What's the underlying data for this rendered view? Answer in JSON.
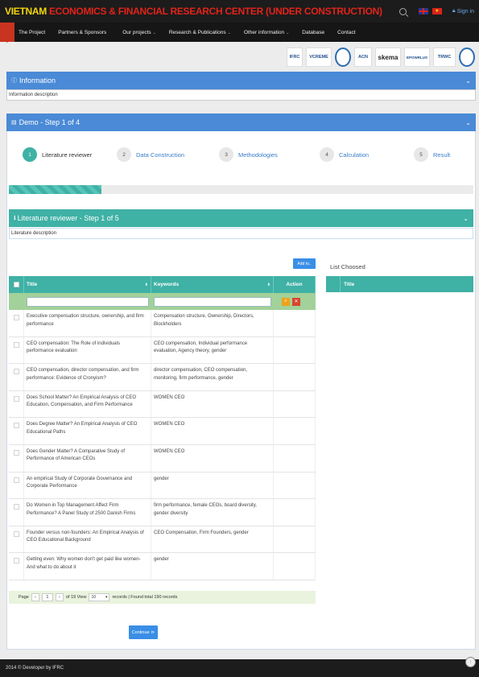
{
  "header": {
    "brand_a": "VIETNAM",
    "brand_b": "ECONOMICS & FINANCIAL RESEARCH CENTER (UNDER CONSTRUCTION)",
    "flag_vn_star": "★",
    "signin": "Sign in"
  },
  "nav": {
    "items": [
      "The Project",
      "Partners & Sponsors",
      "Our projects",
      "Research & Publications",
      "Other information",
      "Database",
      "Contact"
    ],
    "caret": "⌄"
  },
  "partners": [
    "IFRC",
    "VCREME",
    "",
    "ACN",
    "skema",
    "EPOWRLUS",
    "TRWC",
    ""
  ],
  "info": {
    "title": "Information",
    "description": "Information description"
  },
  "demo": {
    "title": "Demo - Step 1 of 4",
    "steps": [
      {
        "num": "1",
        "label": "Literature reviewer"
      },
      {
        "num": "2",
        "label": "Data Construction"
      },
      {
        "num": "3",
        "label": "Methodologies"
      },
      {
        "num": "4",
        "label": "Calculation"
      },
      {
        "num": "5",
        "label": "Result"
      }
    ],
    "progress": 0.2
  },
  "literature": {
    "title": "Literature reviewer - Step 1 of 5",
    "description": "Literature description",
    "add_to": "Add to..",
    "list_choosed": "List Choosed",
    "columns": {
      "title": "Title",
      "keywords": "Keywords",
      "action": "Action"
    },
    "rows": [
      {
        "title": "Executive compensation structure, ownership, and firm performance",
        "keywords": "Compensation structure, Ownership, Directors, Blockholders"
      },
      {
        "title": "CEO compensation: The Role of individuals performance evaluation",
        "keywords": "CEO compensation, Individual performance evaluation, Agency theory, gender"
      },
      {
        "title": "CEO compensation, director compensation, and firm performance: Evidence of Cronyism?",
        "keywords": "director compensation, CEO compensation, monitoring, firm performance, gender"
      },
      {
        "title": "Does School Matter? An Empirical Analysis of CEO Education, Compensation, and Firm Performance",
        "keywords": "WOMEN CEO"
      },
      {
        "title": "Does Degree Matter? An Empirical Analysis of CEO Educational Paths",
        "keywords": "WOMEN CEO"
      },
      {
        "title": "Does Gender Matter? A Comparative Study of Performance of American CEOs",
        "keywords": "WOMEN CEO"
      },
      {
        "title": "An empirical Study of Corporate Governance and Corporate Performance",
        "keywords": "gender"
      },
      {
        "title": "Do Women in Top Management Affect Firm Performance? A Panel Study of 2500 Danish Firms",
        "keywords": "firm performance, female CEOs, board diversity, gender diversity"
      },
      {
        "title": "Founder versus non-founders: An Empirical Analysis of CEO Educational Background",
        "keywords": "CEO Compensation, Firm Founders, gender"
      },
      {
        "title": "Getting even: Why women don't get paid like women- And what to do about it",
        "keywords": "gender"
      }
    ],
    "pager": {
      "page_label": "Page",
      "page_value": "1",
      "of_label": "of 19 View",
      "view_value": "10",
      "records_text": "records | Found total 190 records"
    },
    "right_columns": {
      "title": "Title"
    }
  },
  "continue_label": "Continue",
  "footer": "2014 © Developer by IFRC",
  "colors": {
    "teal": "#3fb1a5",
    "blue": "#4a8ad6",
    "button_blue": "#3a8ee6"
  }
}
